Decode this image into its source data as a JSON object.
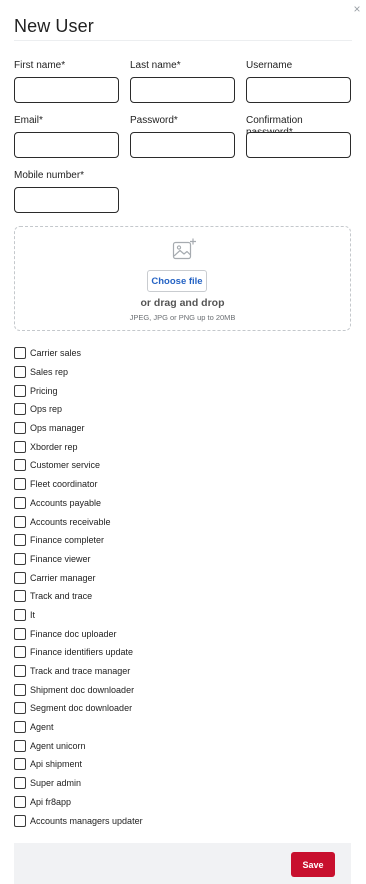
{
  "dialog": {
    "title": "New User",
    "close_glyph": "×"
  },
  "fields": {
    "first_name": {
      "label": "First name",
      "required_mark": "*",
      "value": ""
    },
    "last_name": {
      "label": "Last name",
      "required_mark": "*",
      "value": ""
    },
    "username": {
      "label": "Username",
      "required_mark": "",
      "value": ""
    },
    "email": {
      "label": "Email",
      "required_mark": "*",
      "value": ""
    },
    "password": {
      "label": "Password",
      "required_mark": "*",
      "value": ""
    },
    "confirm_password": {
      "label": "Confirmation password",
      "required_mark": "*",
      "value": ""
    },
    "mobile": {
      "label": "Mobile number",
      "required_mark": "*",
      "value": ""
    }
  },
  "upload": {
    "icon": "image-add-icon",
    "choose_label": "Choose file",
    "drag_text": "or drag and drop",
    "hint": "JPEG, JPG or PNG up to 20MB"
  },
  "roles": [
    {
      "label": "Carrier sales",
      "checked": false
    },
    {
      "label": "Sales rep",
      "checked": false
    },
    {
      "label": "Pricing",
      "checked": false
    },
    {
      "label": "Ops rep",
      "checked": false
    },
    {
      "label": "Ops manager",
      "checked": false
    },
    {
      "label": "Xborder rep",
      "checked": false
    },
    {
      "label": "Customer service",
      "checked": false
    },
    {
      "label": "Fleet coordinator",
      "checked": false
    },
    {
      "label": "Accounts payable",
      "checked": false
    },
    {
      "label": "Accounts receivable",
      "checked": false
    },
    {
      "label": "Finance completer",
      "checked": false
    },
    {
      "label": "Finance viewer",
      "checked": false
    },
    {
      "label": "Carrier manager",
      "checked": false
    },
    {
      "label": "Track and trace",
      "checked": false
    },
    {
      "label": "It",
      "checked": false
    },
    {
      "label": "Finance doc uploader",
      "checked": false
    },
    {
      "label": "Finance identifiers update",
      "checked": false
    },
    {
      "label": "Track and trace manager",
      "checked": false
    },
    {
      "label": "Shipment doc downloader",
      "checked": false
    },
    {
      "label": "Segment doc downloader",
      "checked": false
    },
    {
      "label": "Agent",
      "checked": false
    },
    {
      "label": "Agent unicorn",
      "checked": false
    },
    {
      "label": "Api shipment",
      "checked": false
    },
    {
      "label": "Super admin",
      "checked": false
    },
    {
      "label": "Api fr8app",
      "checked": false
    },
    {
      "label": "Accounts managers updater",
      "checked": false
    }
  ],
  "footer": {
    "save_label": "Save"
  },
  "colors": {
    "accent": "#c8102e",
    "link": "#2563c4",
    "footer_bg": "#f1f2f4"
  }
}
